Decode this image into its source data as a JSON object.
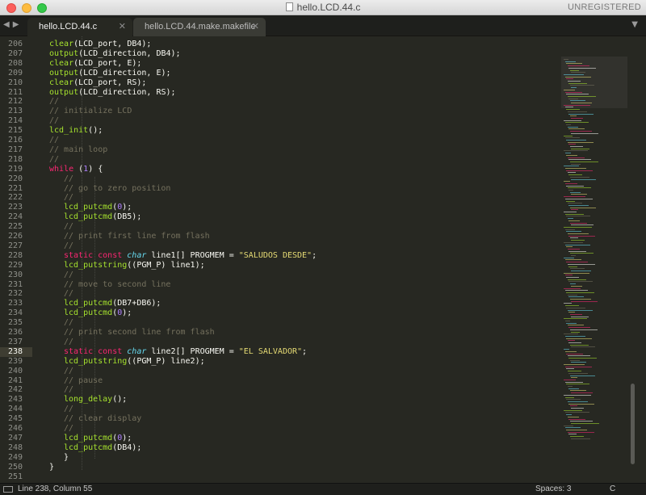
{
  "window": {
    "title": "hello.LCD.44.c",
    "registration": "UNREGISTERED"
  },
  "tabs": [
    {
      "label": "hello.LCD.44.c",
      "active": true
    },
    {
      "label": "hello.LCD.44.make.makefile",
      "active": false
    }
  ],
  "editor": {
    "current_line": 238,
    "lines": [
      {
        "num": "206",
        "indent": 1,
        "tokens": [
          [
            "fn",
            "clear"
          ],
          [
            "",
            "(LCD_port, DB4);"
          ]
        ]
      },
      {
        "num": "207",
        "indent": 1,
        "tokens": [
          [
            "fn",
            "output"
          ],
          [
            "",
            "(LCD_direction, DB4);"
          ]
        ]
      },
      {
        "num": "208",
        "indent": 1,
        "tokens": [
          [
            "fn",
            "clear"
          ],
          [
            "",
            "(LCD_port, E);"
          ]
        ]
      },
      {
        "num": "209",
        "indent": 1,
        "tokens": [
          [
            "fn",
            "output"
          ],
          [
            "",
            "(LCD_direction, E);"
          ]
        ]
      },
      {
        "num": "210",
        "indent": 1,
        "tokens": [
          [
            "fn",
            "clear"
          ],
          [
            "",
            "(LCD_port, RS);"
          ]
        ]
      },
      {
        "num": "211",
        "indent": 1,
        "tokens": [
          [
            "fn",
            "output"
          ],
          [
            "",
            "(LCD_direction, RS);"
          ]
        ]
      },
      {
        "num": "212",
        "indent": 1,
        "tokens": [
          [
            "cm",
            "//"
          ]
        ]
      },
      {
        "num": "213",
        "indent": 1,
        "tokens": [
          [
            "cm",
            "// initialize LCD"
          ]
        ]
      },
      {
        "num": "214",
        "indent": 1,
        "tokens": [
          [
            "cm",
            "//"
          ]
        ]
      },
      {
        "num": "215",
        "indent": 1,
        "tokens": [
          [
            "fn",
            "lcd_init"
          ],
          [
            "",
            "();"
          ]
        ]
      },
      {
        "num": "216",
        "indent": 1,
        "tokens": [
          [
            "cm",
            "//"
          ]
        ]
      },
      {
        "num": "217",
        "indent": 1,
        "tokens": [
          [
            "cm",
            "// main loop"
          ]
        ]
      },
      {
        "num": "218",
        "indent": 1,
        "tokens": [
          [
            "cm",
            "//"
          ]
        ]
      },
      {
        "num": "219",
        "indent": 1,
        "tokens": [
          [
            "kw",
            "while"
          ],
          [
            "",
            " ("
          ],
          [
            "nu",
            "1"
          ],
          [
            "",
            ") {"
          ]
        ]
      },
      {
        "num": "220",
        "indent": 2,
        "tokens": [
          [
            "cm",
            "//"
          ]
        ]
      },
      {
        "num": "221",
        "indent": 2,
        "tokens": [
          [
            "cm",
            "// go to zero position"
          ]
        ]
      },
      {
        "num": "222",
        "indent": 2,
        "tokens": [
          [
            "cm",
            "//"
          ]
        ]
      },
      {
        "num": "223",
        "indent": 2,
        "tokens": [
          [
            "fn",
            "lcd_putcmd"
          ],
          [
            "",
            "("
          ],
          [
            "nu",
            "0"
          ],
          [
            "",
            ");"
          ]
        ]
      },
      {
        "num": "224",
        "indent": 2,
        "tokens": [
          [
            "fn",
            "lcd_putcmd"
          ],
          [
            "",
            "(DB5);"
          ]
        ]
      },
      {
        "num": "225",
        "indent": 2,
        "tokens": [
          [
            "cm",
            "//"
          ]
        ]
      },
      {
        "num": "226",
        "indent": 2,
        "tokens": [
          [
            "cm",
            "// print first line from flash"
          ]
        ]
      },
      {
        "num": "227",
        "indent": 2,
        "tokens": [
          [
            "cm",
            "//"
          ]
        ]
      },
      {
        "num": "228",
        "indent": 2,
        "tokens": [
          [
            "kw",
            "static const "
          ],
          [
            "ty",
            "char"
          ],
          [
            "",
            " line1[] PROGMEM = "
          ],
          [
            "st",
            "\"SALUDOS DESDE\""
          ],
          [
            "",
            ";"
          ]
        ]
      },
      {
        "num": "229",
        "indent": 2,
        "tokens": [
          [
            "fn",
            "lcd_putstring"
          ],
          [
            "",
            "((PGM_P) line1);"
          ]
        ]
      },
      {
        "num": "230",
        "indent": 2,
        "tokens": [
          [
            "cm",
            "//"
          ]
        ]
      },
      {
        "num": "231",
        "indent": 2,
        "tokens": [
          [
            "cm",
            "// move to second line"
          ]
        ]
      },
      {
        "num": "232",
        "indent": 2,
        "tokens": [
          [
            "cm",
            "//"
          ]
        ]
      },
      {
        "num": "233",
        "indent": 2,
        "tokens": [
          [
            "fn",
            "lcd_putcmd"
          ],
          [
            "",
            "(DB7+DB6);"
          ]
        ]
      },
      {
        "num": "234",
        "indent": 2,
        "tokens": [
          [
            "fn",
            "lcd_putcmd"
          ],
          [
            "",
            "("
          ],
          [
            "nu",
            "0"
          ],
          [
            "",
            ");"
          ]
        ]
      },
      {
        "num": "235",
        "indent": 2,
        "tokens": [
          [
            "cm",
            "//"
          ]
        ]
      },
      {
        "num": "236",
        "indent": 2,
        "tokens": [
          [
            "cm",
            "// print second line from flash"
          ]
        ]
      },
      {
        "num": "237",
        "indent": 2,
        "tokens": [
          [
            "cm",
            "//"
          ]
        ]
      },
      {
        "num": "238",
        "indent": 2,
        "tokens": [
          [
            "kw",
            "static const "
          ],
          [
            "ty",
            "char"
          ],
          [
            "",
            " line2[] PROGMEM = "
          ],
          [
            "st",
            "\"EL SALVADOR\""
          ],
          [
            "",
            ";"
          ]
        ]
      },
      {
        "num": "239",
        "indent": 2,
        "tokens": [
          [
            "fn",
            "lcd_putstring"
          ],
          [
            "",
            "((PGM_P) line2);"
          ]
        ]
      },
      {
        "num": "240",
        "indent": 2,
        "tokens": [
          [
            "cm",
            "//"
          ]
        ]
      },
      {
        "num": "241",
        "indent": 2,
        "tokens": [
          [
            "cm",
            "// pause"
          ]
        ]
      },
      {
        "num": "242",
        "indent": 2,
        "tokens": [
          [
            "cm",
            "//"
          ]
        ]
      },
      {
        "num": "243",
        "indent": 2,
        "tokens": [
          [
            "fn",
            "long_delay"
          ],
          [
            "",
            "();"
          ]
        ]
      },
      {
        "num": "244",
        "indent": 2,
        "tokens": [
          [
            "cm",
            "//"
          ]
        ]
      },
      {
        "num": "245",
        "indent": 2,
        "tokens": [
          [
            "cm",
            "// clear display"
          ]
        ]
      },
      {
        "num": "246",
        "indent": 2,
        "tokens": [
          [
            "cm",
            "//"
          ]
        ]
      },
      {
        "num": "247",
        "indent": 2,
        "tokens": [
          [
            "fn",
            "lcd_putcmd"
          ],
          [
            "",
            "("
          ],
          [
            "nu",
            "0"
          ],
          [
            "",
            ");"
          ]
        ]
      },
      {
        "num": "248",
        "indent": 2,
        "tokens": [
          [
            "fn",
            "lcd_putcmd"
          ],
          [
            "",
            "(DB4);"
          ]
        ]
      },
      {
        "num": "249",
        "indent": 2,
        "tokens": [
          [
            "",
            "}"
          ]
        ]
      },
      {
        "num": "250",
        "indent": 1,
        "tokens": [
          [
            "",
            "}"
          ]
        ]
      },
      {
        "num": "251",
        "indent": 0,
        "tokens": []
      }
    ]
  },
  "statusbar": {
    "position": "Line 238, Column 55",
    "indentation": "Spaces: 3",
    "syntax": "C"
  },
  "colors": {
    "background": "#272822",
    "comment": "#75715e",
    "keyword": "#f92672",
    "string": "#e6db74",
    "number": "#ae81ff",
    "type": "#66d9ef",
    "function": "#a6e22e"
  },
  "icons": [
    "close-window-icon",
    "minimize-window-icon",
    "maximize-window-icon",
    "document-icon",
    "nav-arrows-icon",
    "tab-close-icon",
    "tab-menu-icon",
    "panel-toggle-icon"
  ]
}
